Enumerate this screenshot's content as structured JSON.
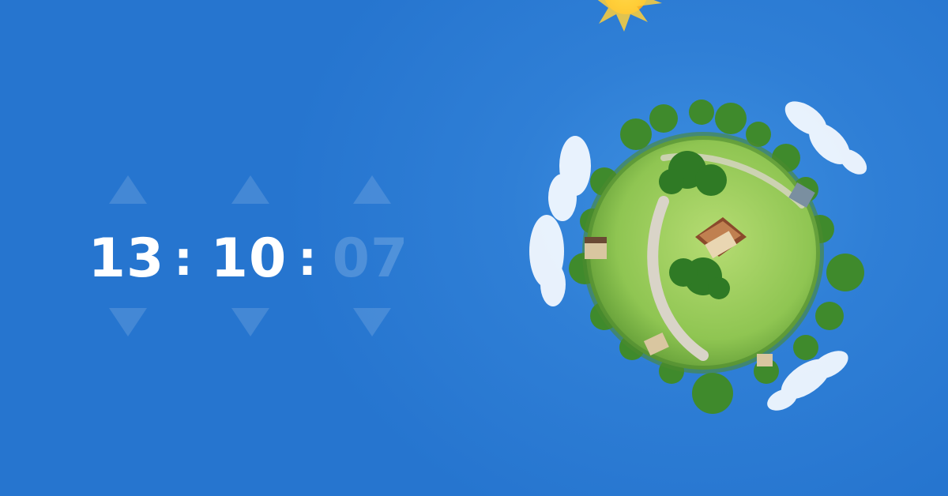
{
  "clock": {
    "hours": "13",
    "minutes": "10",
    "seconds": "07",
    "separator": ":"
  },
  "colors": {
    "sky": "#2675cf",
    "digits": "#ffffff",
    "planet_grass": "#9fcf5a",
    "sun": "#ffd23a"
  },
  "icons": [
    "increment-arrow-icon",
    "decrement-arrow-icon",
    "sun-icon",
    "cloud-icon",
    "tiny-planet-illustration"
  ]
}
